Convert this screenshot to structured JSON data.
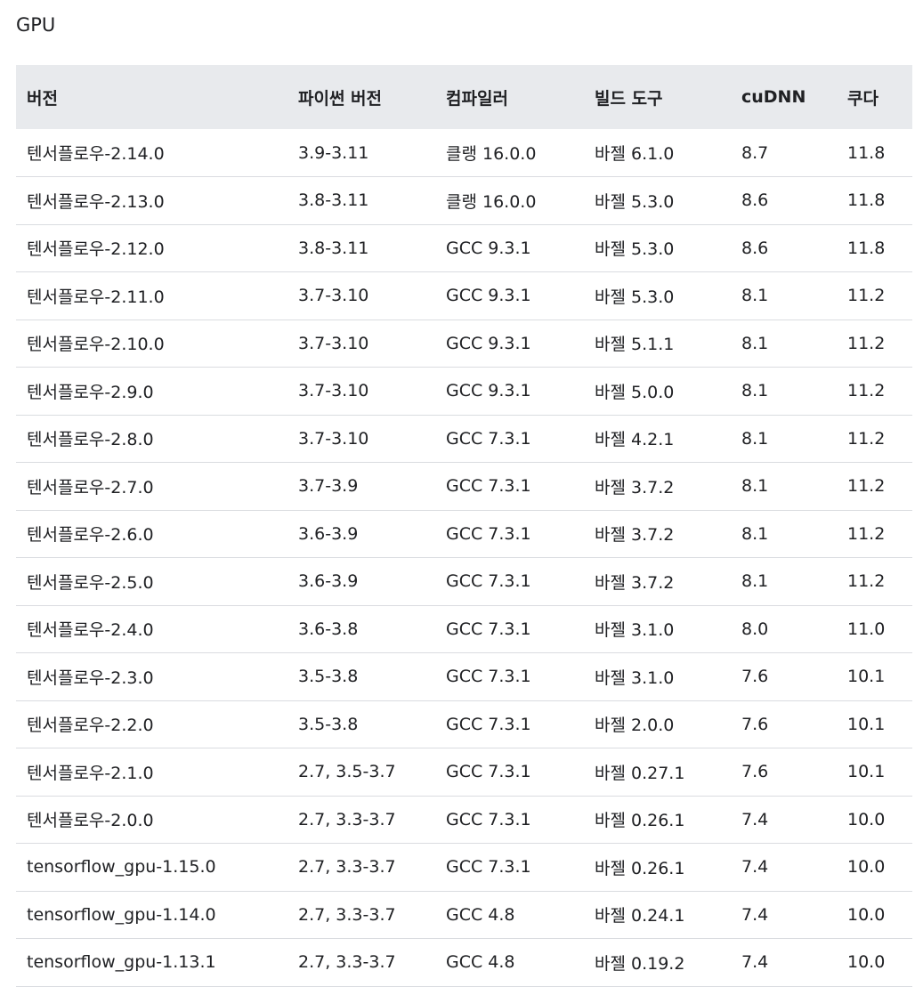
{
  "section_title": "GPU",
  "table": {
    "headers": [
      "버전",
      "파이썬 버전",
      "컴파일러",
      "빌드 도구",
      "cuDNN",
      "쿠다"
    ],
    "rows": [
      [
        "텐서플로우-2.14.0",
        "3.9-3.11",
        "클랭 16.0.0",
        "바젤 6.1.0",
        "8.7",
        "11.8"
      ],
      [
        "텐서플로우-2.13.0",
        "3.8-3.11",
        "클랭 16.0.0",
        "바젤 5.3.0",
        "8.6",
        "11.8"
      ],
      [
        "텐서플로우-2.12.0",
        "3.8-3.11",
        "GCC 9.3.1",
        "바젤 5.3.0",
        "8.6",
        "11.8"
      ],
      [
        "텐서플로우-2.11.0",
        "3.7-3.10",
        "GCC 9.3.1",
        "바젤 5.3.0",
        "8.1",
        "11.2"
      ],
      [
        "텐서플로우-2.10.0",
        "3.7-3.10",
        "GCC 9.3.1",
        "바젤 5.1.1",
        "8.1",
        "11.2"
      ],
      [
        "텐서플로우-2.9.0",
        "3.7-3.10",
        "GCC 9.3.1",
        "바젤 5.0.0",
        "8.1",
        "11.2"
      ],
      [
        "텐서플로우-2.8.0",
        "3.7-3.10",
        "GCC 7.3.1",
        "바젤 4.2.1",
        "8.1",
        "11.2"
      ],
      [
        "텐서플로우-2.7.0",
        "3.7-3.9",
        "GCC 7.3.1",
        "바젤 3.7.2",
        "8.1",
        "11.2"
      ],
      [
        "텐서플로우-2.6.0",
        "3.6-3.9",
        "GCC 7.3.1",
        "바젤 3.7.2",
        "8.1",
        "11.2"
      ],
      [
        "텐서플로우-2.5.0",
        "3.6-3.9",
        "GCC 7.3.1",
        "바젤 3.7.2",
        "8.1",
        "11.2"
      ],
      [
        "텐서플로우-2.4.0",
        "3.6-3.8",
        "GCC 7.3.1",
        "바젤 3.1.0",
        "8.0",
        "11.0"
      ],
      [
        "텐서플로우-2.3.0",
        "3.5-3.8",
        "GCC 7.3.1",
        "바젤 3.1.0",
        "7.6",
        "10.1"
      ],
      [
        "텐서플로우-2.2.0",
        "3.5-3.8",
        "GCC 7.3.1",
        "바젤 2.0.0",
        "7.6",
        "10.1"
      ],
      [
        "텐서플로우-2.1.0",
        "2.7, 3.5-3.7",
        "GCC 7.3.1",
        "바젤 0.27.1",
        "7.6",
        "10.1"
      ],
      [
        "텐서플로우-2.0.0",
        "2.7, 3.3-3.7",
        "GCC 7.3.1",
        "바젤 0.26.1",
        "7.4",
        "10.0"
      ],
      [
        "tensorflow_gpu-1.15.0",
        "2.7, 3.3-3.7",
        "GCC 7.3.1",
        "바젤 0.26.1",
        "7.4",
        "10.0"
      ],
      [
        "tensorflow_gpu-1.14.0",
        "2.7, 3.3-3.7",
        "GCC 4.8",
        "바젤 0.24.1",
        "7.4",
        "10.0"
      ],
      [
        "tensorflow_gpu-1.13.1",
        "2.7, 3.3-3.7",
        "GCC 4.8",
        "바젤 0.19.2",
        "7.4",
        "10.0"
      ]
    ]
  }
}
